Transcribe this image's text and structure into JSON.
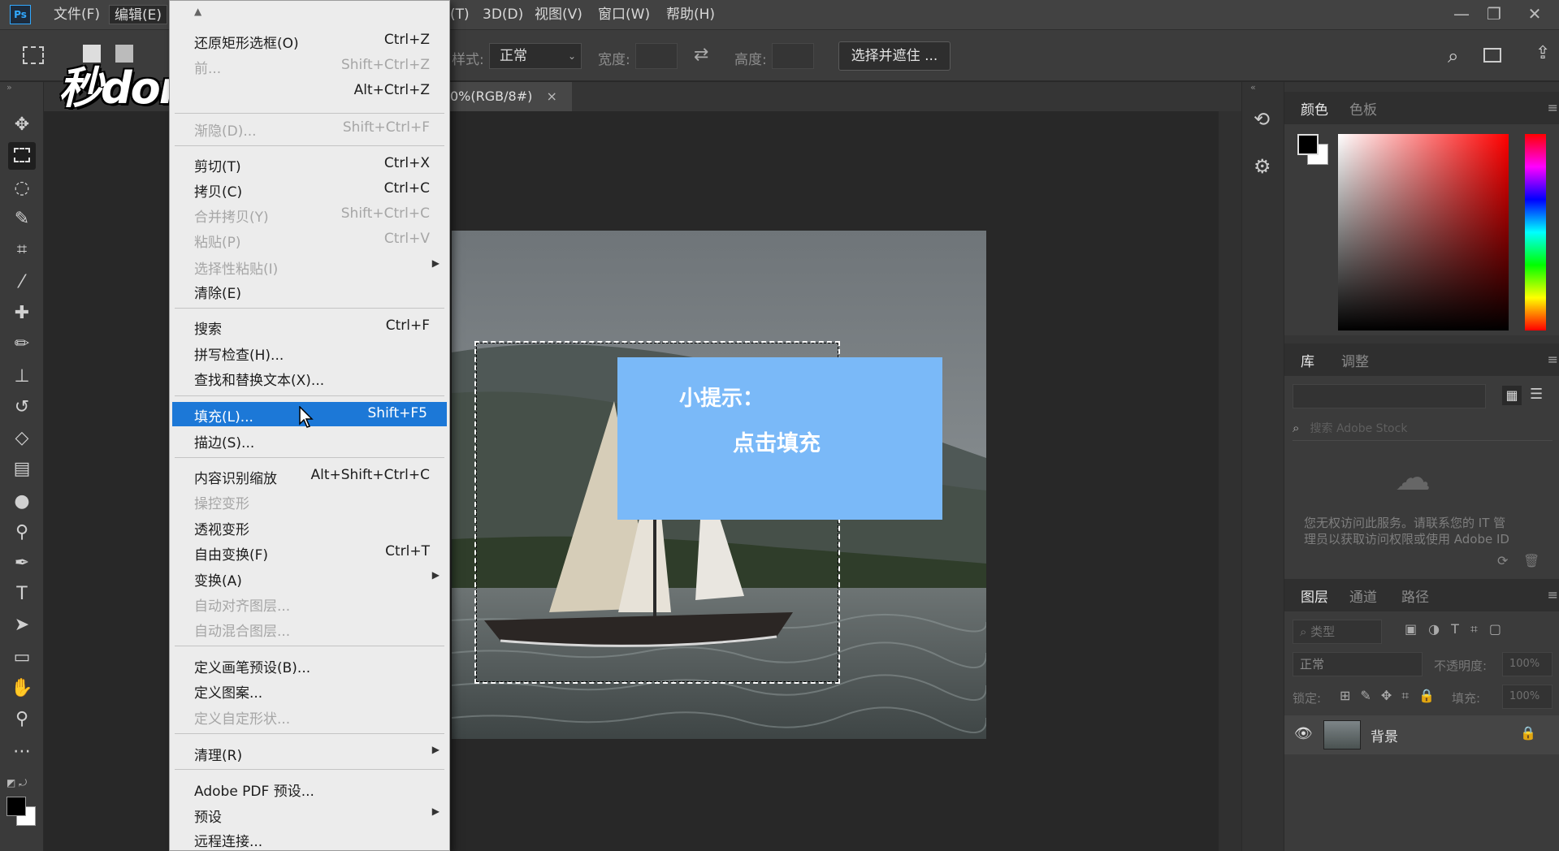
{
  "app": {
    "logo": "Ps"
  },
  "menubar": {
    "items": [
      "文件(F)",
      "编辑(E)",
      "(T)",
      "3D(D)",
      "视图(V)",
      "窗口(W)",
      "帮助(H)"
    ],
    "window_buttons": [
      "—",
      "❐",
      "✕"
    ]
  },
  "options": {
    "style_label": "样式:",
    "style_value": "正常",
    "width_label": "宽度:",
    "height_label": "高度:",
    "select_mask_button": "选择并遮住 ..."
  },
  "document": {
    "tab_label": "0%(RGB/8#)",
    "tab_close": "×",
    "tip_title": "小提示：",
    "tip_body": "点击填充"
  },
  "watermark": "秒dong视频",
  "edit_menu": {
    "items": [
      {
        "label": "还原矩形选框(O)",
        "shortcut": "Ctrl+Z",
        "disabled": false
      },
      {
        "label": "前...",
        "shortcut": "Shift+Ctrl+Z",
        "disabled": true
      },
      {
        "label": "",
        "shortcut": "Alt+Ctrl+Z",
        "disabled": false
      },
      {
        "label": "渐隐(D)...",
        "shortcut": "Shift+Ctrl+F",
        "disabled": true
      },
      {
        "label": "剪切(T)",
        "shortcut": "Ctrl+X",
        "disabled": false
      },
      {
        "label": "拷贝(C)",
        "shortcut": "Ctrl+C",
        "disabled": false
      },
      {
        "label": "合并拷贝(Y)",
        "shortcut": "Shift+Ctrl+C",
        "disabled": true
      },
      {
        "label": "粘贴(P)",
        "shortcut": "Ctrl+V",
        "disabled": true
      },
      {
        "label": "选择性粘贴(I)",
        "shortcut": "",
        "disabled": true,
        "submenu": true
      },
      {
        "label": "清除(E)",
        "shortcut": "",
        "disabled": false
      },
      {
        "label": "搜索",
        "shortcut": "Ctrl+F",
        "disabled": false
      },
      {
        "label": "拼写检查(H)...",
        "shortcut": "",
        "disabled": false
      },
      {
        "label": "查找和替换文本(X)...",
        "shortcut": "",
        "disabled": false
      },
      {
        "label": "填充(L)...",
        "shortcut": "Shift+F5",
        "disabled": false,
        "highlight": true
      },
      {
        "label": "描边(S)...",
        "shortcut": "",
        "disabled": false
      },
      {
        "label": "内容识别缩放",
        "shortcut": "Alt+Shift+Ctrl+C",
        "disabled": false
      },
      {
        "label": "操控变形",
        "shortcut": "",
        "disabled": true
      },
      {
        "label": "透视变形",
        "shortcut": "",
        "disabled": false
      },
      {
        "label": "自由变换(F)",
        "shortcut": "Ctrl+T",
        "disabled": false
      },
      {
        "label": "变换(A)",
        "shortcut": "",
        "disabled": false,
        "submenu": true
      },
      {
        "label": "自动对齐图层...",
        "shortcut": "",
        "disabled": true
      },
      {
        "label": "自动混合图层...",
        "shortcut": "",
        "disabled": true
      },
      {
        "label": "定义画笔预设(B)...",
        "shortcut": "",
        "disabled": false
      },
      {
        "label": "定义图案...",
        "shortcut": "",
        "disabled": false
      },
      {
        "label": "定义自定形状...",
        "shortcut": "",
        "disabled": true
      },
      {
        "label": "清理(R)",
        "shortcut": "",
        "disabled": false,
        "submenu": true
      },
      {
        "label": "Adobe PDF 预设...",
        "shortcut": "",
        "disabled": false
      },
      {
        "label": "预设",
        "shortcut": "",
        "disabled": false,
        "submenu": true
      },
      {
        "label": "远程连接...",
        "shortcut": "",
        "disabled": false
      }
    ]
  },
  "panels": {
    "color_tabs": [
      "颜色",
      "色板"
    ],
    "library_tabs": [
      "库",
      "调整"
    ],
    "library_search_placeholder": "搜索 Adobe Stock",
    "library_message_line1": "您无权访问此服务。请联系您的 IT 管",
    "library_message_line2": "理员以获取访问权限或使用 Adobe ID",
    "layers_tabs": [
      "图层",
      "通道",
      "路径"
    ],
    "layers_filter": "类型",
    "blend_mode": "正常",
    "opacity_label": "不透明度:",
    "opacity_value": "100%",
    "lock_label": "锁定:",
    "fill_label": "填充:",
    "fill_value": "100%",
    "layer_name": "背景"
  },
  "colors": {
    "highlight": "#1c78d7",
    "tip_box": "#7ab9f8",
    "ps_blue": "#31a8ff"
  }
}
